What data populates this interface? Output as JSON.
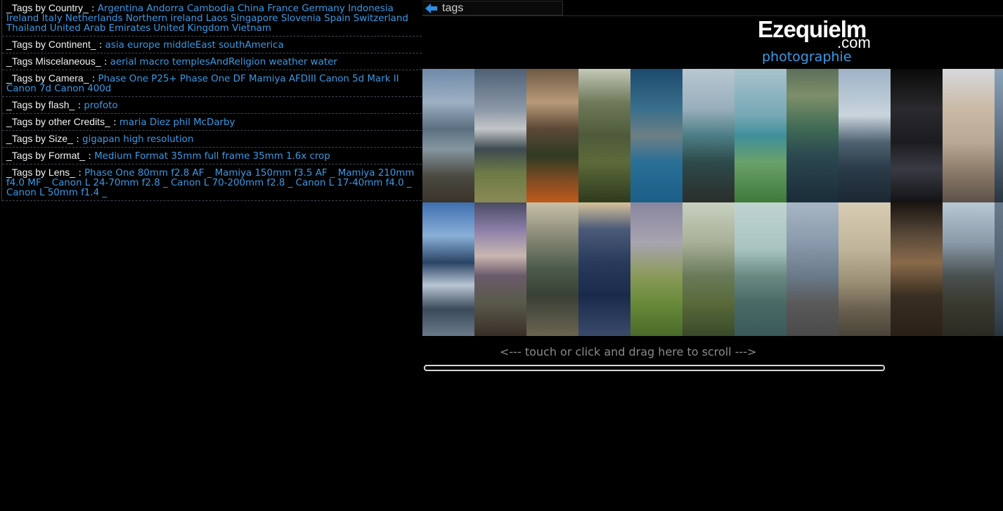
{
  "tags": [
    {
      "label": "_Tags by Country_",
      "links": [
        "Argentina",
        "Andorra",
        "Cambodia",
        "China",
        "France",
        "Germany",
        "Indonesia",
        "Ireland",
        "Italy",
        "Netherlands",
        "Northern ireland",
        "Laos",
        "Singapore",
        "Slovenia",
        "Spain",
        "Switzerland",
        "Thailand",
        "United Arab Emirates",
        "United Kingdom",
        "Vietnam"
      ]
    },
    {
      "label": "_Tags by Continent_",
      "links": [
        "asia",
        "europe",
        "middleEast",
        "southAmerica"
      ]
    },
    {
      "label": "_Tags Miscelaneous_",
      "links": [
        "aerial",
        "macro",
        "templesAndReligion",
        "weather",
        "water"
      ]
    },
    {
      "label": "_Tags by Camera_",
      "links": [
        "Phase One P25+",
        "Phase One DF",
        "Mamiya AFDIII",
        "Canon 5d Mark II",
        "Canon 7d",
        "Canon 400d"
      ]
    },
    {
      "label": "_Tags by flash_",
      "links": [
        "profoto"
      ]
    },
    {
      "label": "_Tags by other Credits_",
      "links": [
        "maria Diez",
        "phil McDarby"
      ]
    },
    {
      "label": "_Tags by Size_",
      "links": [
        "gigapan",
        "high resolution"
      ]
    },
    {
      "label": "_Tags by Format_",
      "links": [
        "Medium Format",
        "35mm full frame",
        "35mm 1.6x crop"
      ]
    },
    {
      "label": "_Tags by Lens_",
      "links": [
        "Phase One 80mm f2.8 AF _",
        "Mamiya 150mm f3.5 AF _",
        "Mamiya 210mm f4.0 MF _",
        "Canon L 24-70mm f2.8 _",
        "Canon L 70-200mm f2.8 _",
        "Canon L 17-40mm f4.0 _",
        "Canon L 50mm f1.4 _"
      ]
    }
  ],
  "tag_separator": " : ",
  "nav": {
    "back_label": "tags",
    "back_icon": "left-arrow-icon"
  },
  "logo": {
    "brand": "Ezequielm",
    "domain": ".com",
    "tagline": "photographie"
  },
  "scroll_hint": "<--- touch or click and drag here to scroll  --->",
  "colors": {
    "link": "#3a9ae6",
    "background": "#000000",
    "text": "#f2f2f2"
  }
}
